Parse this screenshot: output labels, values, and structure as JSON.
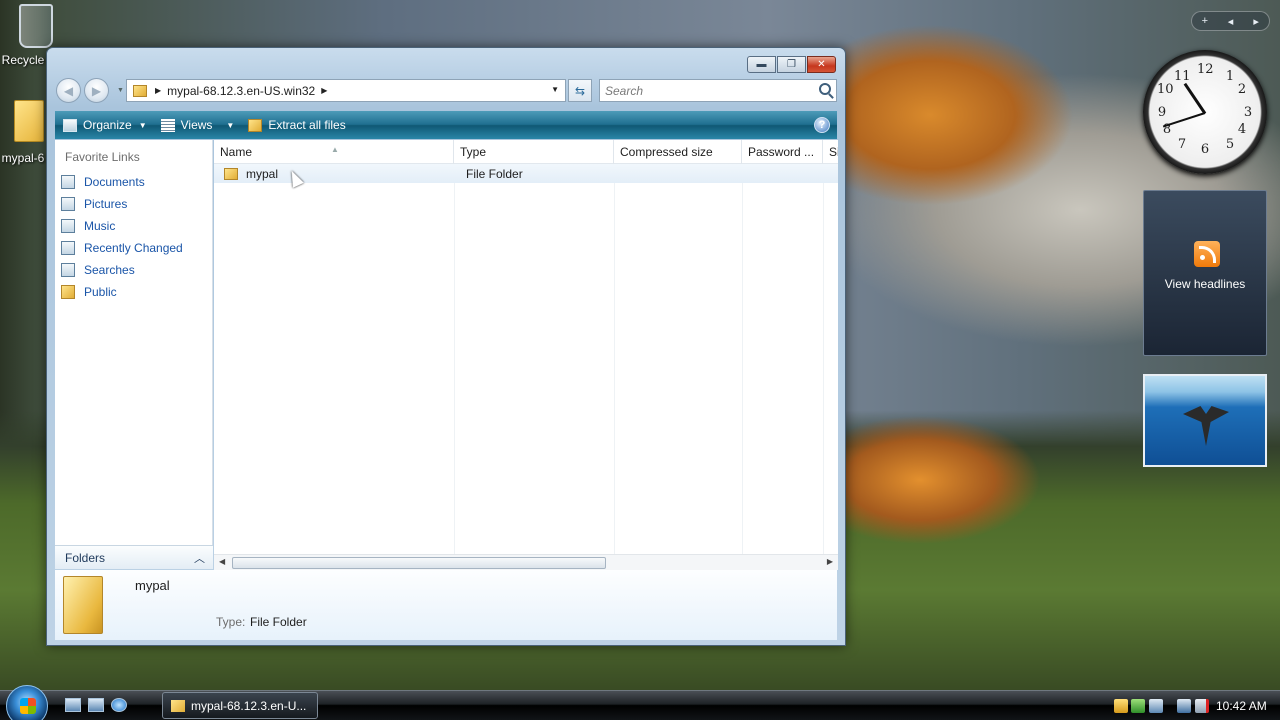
{
  "desktop": {
    "recycle_label": "Recycle",
    "folder_label": "mypal-6"
  },
  "window": {
    "address_path": "mypal-68.12.3.en-US.win32",
    "search_placeholder": "Search",
    "toolbar": {
      "organize": "Organize",
      "views": "Views",
      "extract": "Extract all files",
      "help": "?"
    },
    "nav": {
      "heading": "Favorite Links",
      "links": [
        "Documents",
        "Pictures",
        "Music",
        "Recently Changed",
        "Searches",
        "Public"
      ],
      "folders_label": "Folders"
    },
    "columns": [
      "Name",
      "Type",
      "Compressed size",
      "Password ...",
      "Si"
    ],
    "rows": [
      {
        "name": "mypal",
        "type": "File Folder"
      }
    ],
    "details": {
      "name": "mypal",
      "type_label": "Type:",
      "type_value": "File Folder"
    }
  },
  "gadgets": {
    "clock_numbers": [
      "12",
      "1",
      "2",
      "3",
      "4",
      "5",
      "6",
      "7",
      "8",
      "9",
      "10",
      "11"
    ],
    "rss_label": "View headlines",
    "top_controls": [
      "+",
      "◂",
      "▸"
    ]
  },
  "taskbar": {
    "task_label": "mypal-68.12.3.en-U...",
    "time": "10:42 AM"
  }
}
